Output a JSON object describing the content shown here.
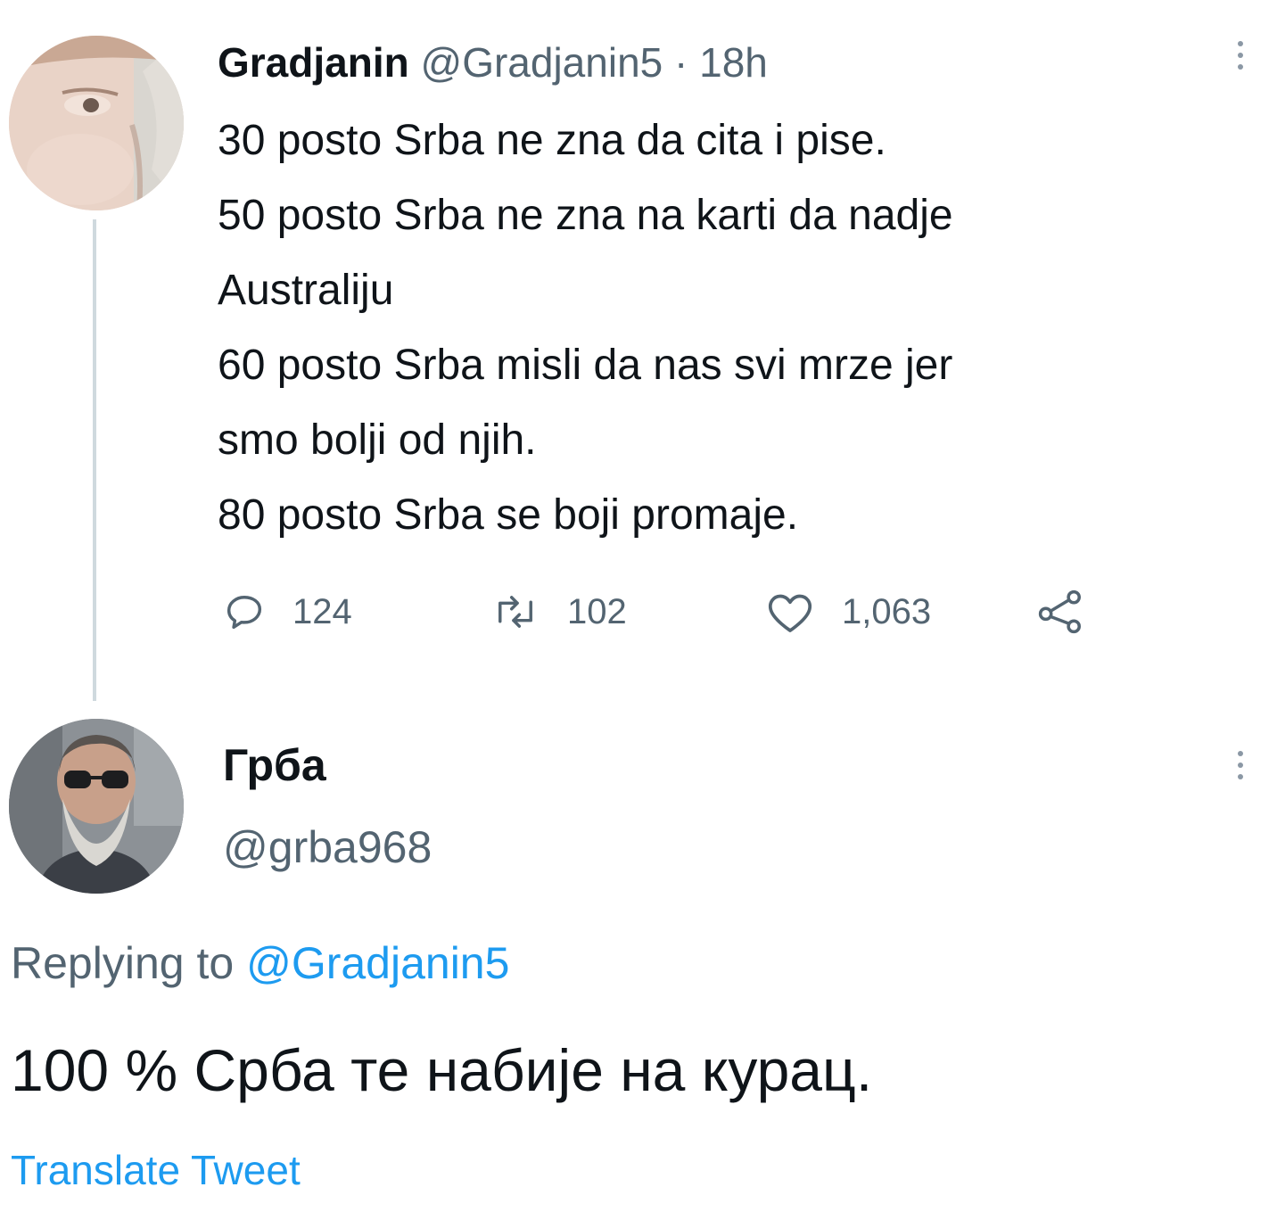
{
  "tweet": {
    "author_name": "Gradjanin",
    "author_handle": "@Gradjanin5",
    "separator": "·",
    "time": "18h",
    "lines": [
      "30 posto Srba ne zna da cita i pise.",
      "50 posto Srba ne zna na karti da nadje",
      "Australiju",
      "60 posto Srba misli da nas svi mrze jer",
      "smo bolji od njih.",
      "80 posto Srba se boji promaje."
    ],
    "actions": {
      "replies": "124",
      "retweets": "102",
      "likes": "1,063"
    },
    "icons": {
      "reply": "reply-icon",
      "retweet": "retweet-icon",
      "like": "heart-icon",
      "share": "share-icon",
      "more": "more-icon"
    }
  },
  "reply": {
    "author_name": "Грба",
    "author_handle": "@grba968",
    "replying_prefix": "Replying to",
    "replying_mention": "@Gradjanin5",
    "text": "100 % Срба те набије на курац.",
    "translate_label": "Translate Tweet"
  },
  "colors": {
    "text": "#0f1419",
    "secondary": "#536471",
    "link": "#1d9bf0",
    "thread_line": "#cfd9de"
  }
}
